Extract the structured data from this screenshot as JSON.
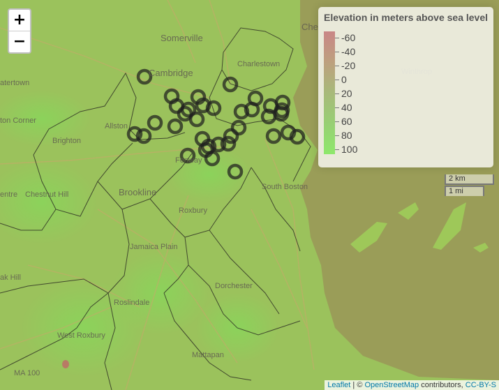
{
  "map": {
    "place_labels": [
      {
        "text": "Somerville",
        "cls": "big"
      },
      {
        "text": "Cambridge",
        "cls": "big"
      },
      {
        "text": "atertown",
        "cls": ""
      },
      {
        "text": "Charlestown",
        "cls": ""
      },
      {
        "text": "Che",
        "cls": "big"
      },
      {
        "text": "Winthrop",
        "cls": ""
      },
      {
        "text": "ton Corner",
        "cls": ""
      },
      {
        "text": "Allston",
        "cls": ""
      },
      {
        "text": "Brighton",
        "cls": ""
      },
      {
        "text": "Fenway",
        "cls": ""
      },
      {
        "text": "Brookline",
        "cls": "big"
      },
      {
        "text": "South Boston",
        "cls": ""
      },
      {
        "text": "entre",
        "cls": ""
      },
      {
        "text": "Chestnut Hill",
        "cls": ""
      },
      {
        "text": "Roxbury",
        "cls": ""
      },
      {
        "text": "Jamaica Plain",
        "cls": ""
      },
      {
        "text": "ak Hill",
        "cls": ""
      },
      {
        "text": "Dorchester",
        "cls": ""
      },
      {
        "text": "Roslindale",
        "cls": ""
      },
      {
        "text": "West Roxbury",
        "cls": ""
      },
      {
        "text": "Mattapan",
        "cls": ""
      },
      {
        "text": "MA 100",
        "cls": ""
      }
    ]
  },
  "zoom": {
    "in_label": "+",
    "out_label": "−"
  },
  "legend": {
    "title": "Elevation in meters above sea level",
    "labels": [
      "-60",
      "-40",
      "-20",
      "0",
      "20",
      "40",
      "60",
      "80",
      "100"
    ]
  },
  "scale": {
    "km": "2 km",
    "mi": "1 mi"
  },
  "attribution": {
    "leaflet": "Leaflet",
    "sep": " | © ",
    "osm": "OpenStreetMap",
    "tail": " contributors, ",
    "license": "CC-BY-S"
  },
  "colors": {
    "low": "#c98686",
    "mid": "#a9b77a",
    "high": "#8ee86b",
    "marker": "#1f1f1f",
    "water": "#9a9d58"
  }
}
